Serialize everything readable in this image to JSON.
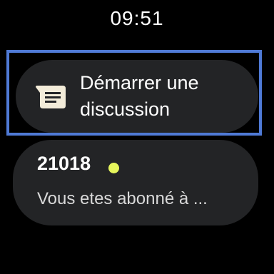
{
  "status": {
    "time": "09:51"
  },
  "start_chat": {
    "label": "Démarrer une discussion",
    "icon": "chat-message-icon"
  },
  "conversations": [
    {
      "title": "21018",
      "unread": true,
      "preview": "Vous etes abonné à ..."
    }
  ],
  "colors": {
    "background": "#000000",
    "chip": "#232426",
    "focus_border": "#4f7ad6",
    "unread_dot": "#e6f65c",
    "icon": "#f3ecd9"
  }
}
